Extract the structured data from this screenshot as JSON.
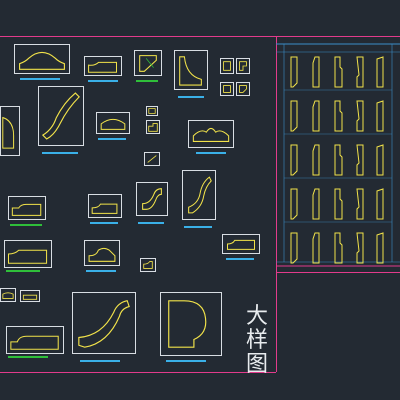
{
  "title": {
    "chars": [
      "大",
      "样",
      "图"
    ]
  },
  "colors": {
    "background": "#232a33",
    "border": "#e23b8c",
    "frame": "#d8dde3",
    "profile": "#f2e34a",
    "dim": "#3ab0e8",
    "dim2": "#2fbf3a"
  },
  "profiles": [
    {
      "name": "arch-crown-profile"
    },
    {
      "name": "ogee-base-profile"
    },
    {
      "name": "corner-square-profile"
    },
    {
      "name": "corner-cove-profile"
    },
    {
      "name": "small-block-profile"
    },
    {
      "name": "step-profile"
    },
    {
      "name": "crown-molding-profile"
    },
    {
      "name": "arch-profile"
    },
    {
      "name": "quarter-round-profile"
    },
    {
      "name": "s-curve-profile"
    },
    {
      "name": "cove-profile"
    },
    {
      "name": "wave-profile"
    },
    {
      "name": "base-step-profile"
    },
    {
      "name": "hill-profile"
    },
    {
      "name": "corner-molding-profile"
    },
    {
      "name": "large-crown-profile"
    },
    {
      "name": "large-cove-profile"
    }
  ],
  "sections_count": 15
}
